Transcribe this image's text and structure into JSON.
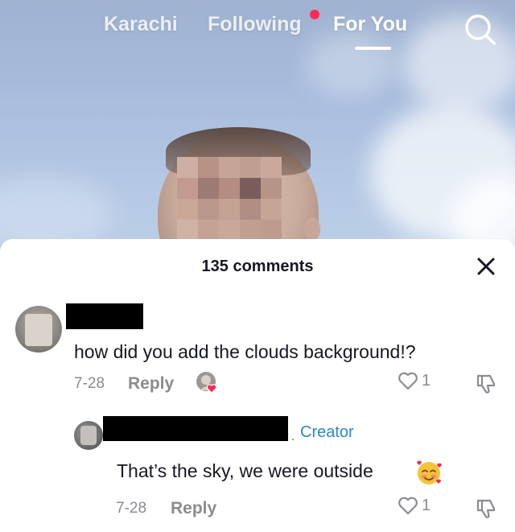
{
  "top_nav": {
    "tabs": [
      {
        "label": "Karachi"
      },
      {
        "label": "Following",
        "has_notification": true
      },
      {
        "label": "For You",
        "active": true
      }
    ],
    "search_icon": "search-icon"
  },
  "comments_panel": {
    "title": "135 comments",
    "close_icon": "close-icon",
    "comments": [
      {
        "username": "",
        "text": "how did you add the clouds background!?",
        "date": "7-28",
        "reply_label": "Reply",
        "liked_by_creator": true,
        "like_count": "1"
      },
      {
        "username": "",
        "badge": "Creator",
        "text": "That’s the sky, we were outside",
        "emoji": "smiling-face-with-hearts",
        "date": "7-28",
        "reply_label": "Reply",
        "like_count": "1"
      }
    ]
  },
  "colors": {
    "accent_red": "#fe2c55",
    "creator_blue": "#2b87c6",
    "text_primary": "#161823",
    "text_secondary": "#8a8b91"
  }
}
